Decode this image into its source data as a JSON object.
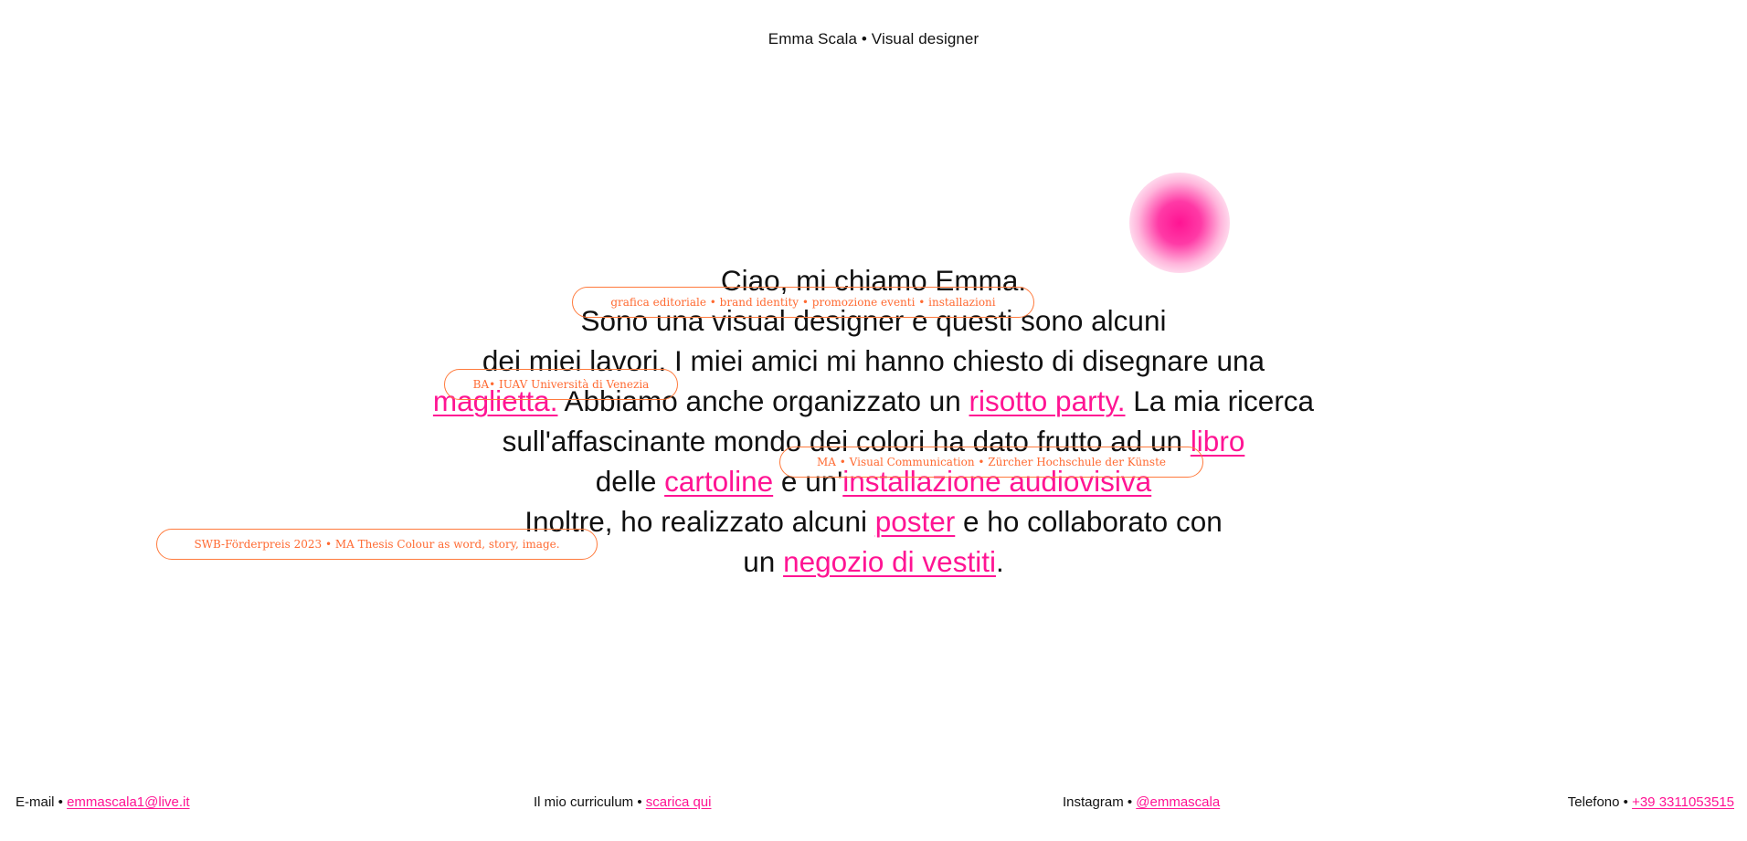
{
  "header": {
    "title": "Emma Scala • Visual designer"
  },
  "intro": {
    "l1": "Ciao, mi chiamo Emma.",
    "l2": "Sono una visual designer e questi sono alcuni",
    "l3": "dei miei lavori. I miei amici mi hanno chiesto di disegnare una",
    "l4_link1": "maglietta.",
    "l4_mid": " Abbiamo anche organizzato un ",
    "l4_link2": "risotto party.",
    "l4_end": " La mia ricerca",
    "l5_start": "sull'affascinante mondo dei colori ha dato frutto ad un ",
    "l5_link": "libro",
    "l6_start": "delle ",
    "l6_link1": "cartoline",
    "l6_mid": " e un'",
    "l6_link2": "installazione audiovisiva",
    "l7_start": "Inoltre, ho realizzato alcuni ",
    "l7_link": "poster",
    "l7_end": " e ho collaborato con",
    "l8_start": "un ",
    "l8_link": "negozio di vestiti",
    "l8_end": "."
  },
  "pills": [
    "grafica editoriale • brand identity • promozione eventi • installazioni",
    "BA• IUAV Università di Venezia",
    "MA • Visual Communication • Zürcher Hochschule der Künste",
    "SWB-Förderpreis 2023 • MA Thesis Colour as word, story, image."
  ],
  "footer": {
    "email_label": "E-mail • ",
    "email_link": "emmascala1@live.it",
    "cv_label": "Il mio curriculum • ",
    "cv_link": "scarica qui",
    "instagram_label": "Instagram • ",
    "instagram_link": "@emmascala",
    "phone_label": "Telefono • ",
    "phone_link": "+39 3311053515"
  },
  "colors": {
    "accent": "#ff1493",
    "pill": "#ff7a3c",
    "text": "#111111",
    "background": "#ffffff"
  }
}
